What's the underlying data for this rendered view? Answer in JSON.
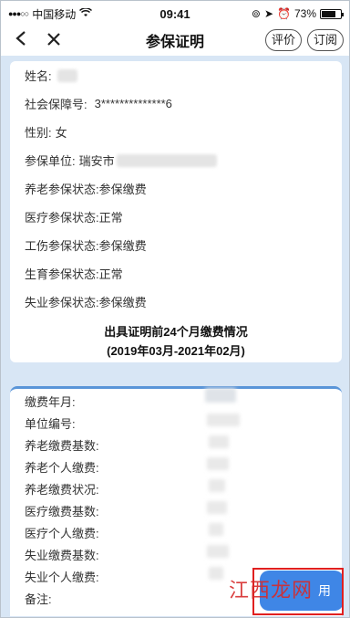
{
  "status_bar": {
    "carrier": "中国移动",
    "time": "09:41",
    "battery": "73%",
    "battery_level": 0.73
  },
  "nav": {
    "title": "参保证明",
    "review_label": "评价",
    "subscribe_label": "订阅"
  },
  "insured_info": {
    "name_label": "姓名:",
    "ssn_label": "社会保障号:",
    "ssn_value": "3**************6",
    "gender_label": "性别:",
    "gender_value": "女",
    "unit_label": "参保单位:",
    "unit_value": "瑞安市",
    "pension_label": "养老参保状态:",
    "pension_value": "参保缴费",
    "medical_label": "医疗参保状态:",
    "medical_value": "正常",
    "injury_label": "工伤参保状态:",
    "injury_value": "参保缴费",
    "maternity_label": "生育参保状态:",
    "maternity_value": "正常",
    "unemployment_label": "失业参保状态:",
    "unemployment_value": "参保缴费"
  },
  "summary": {
    "line1": "出具证明前24个月缴费情况",
    "line2": "(2019年03月-2021年02月)"
  },
  "payment_fields": [
    "缴费年月:",
    "单位编号:",
    "养老缴费基数:",
    "养老个人缴费:",
    "养老缴费状况:",
    "医疗缴费基数:",
    "医疗个人缴费:",
    "失业缴费基数:",
    "失业个人缴费:",
    "备注:"
  ],
  "bottom_button_label": "用",
  "watermark": "江西龙网"
}
